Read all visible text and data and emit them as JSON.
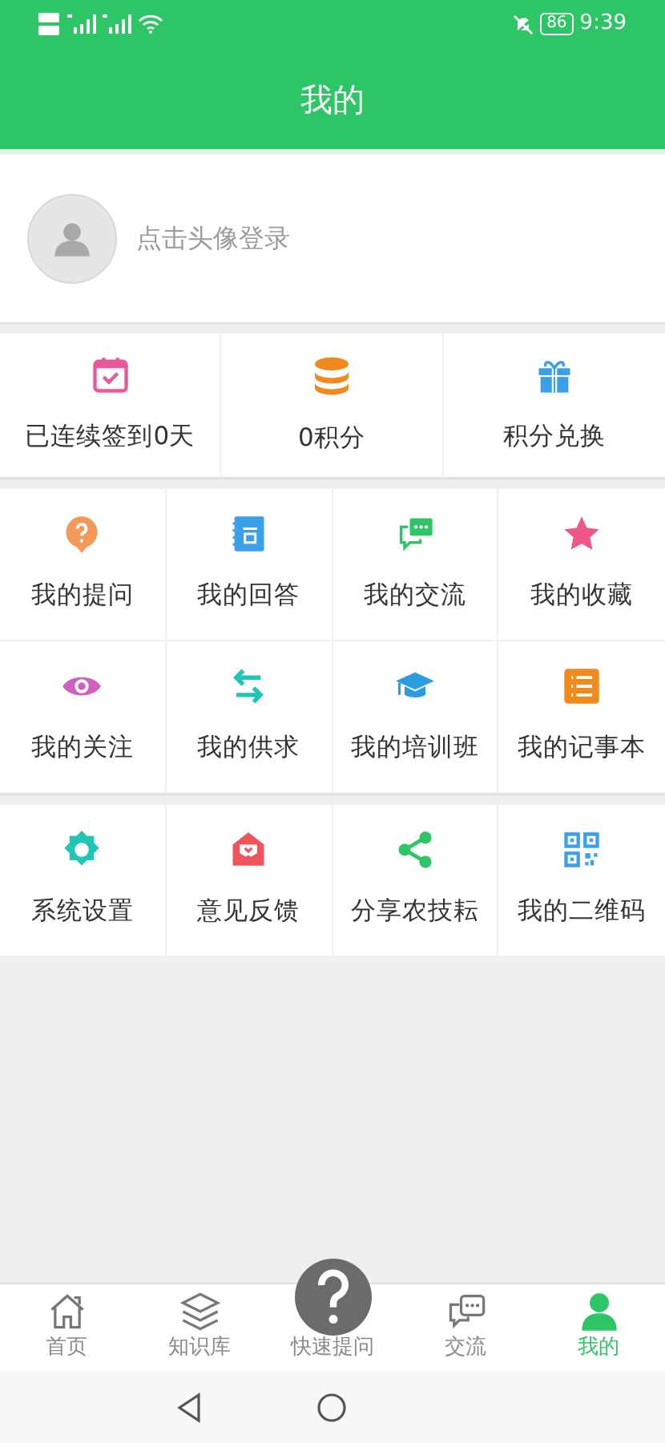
{
  "status_bar": {
    "battery": "86",
    "time": "9:39"
  },
  "header": {
    "title": "我的"
  },
  "profile": {
    "prompt": "点击头像登录"
  },
  "stats": [
    {
      "label": "已连续签到0天"
    },
    {
      "label": "0积分"
    },
    {
      "label": "积分兑换"
    }
  ],
  "menu_groups": [
    [
      {
        "label": "我的提问"
      },
      {
        "label": "我的回答"
      },
      {
        "label": "我的交流"
      },
      {
        "label": "我的收藏"
      },
      {
        "label": "我的关注"
      },
      {
        "label": "我的供求"
      },
      {
        "label": "我的培训班"
      },
      {
        "label": "我的记事本"
      }
    ],
    [
      {
        "label": "系统设置"
      },
      {
        "label": "意见反馈"
      },
      {
        "label": "分享农技耘"
      },
      {
        "label": "我的二维码"
      }
    ]
  ],
  "tab_bar": [
    {
      "label": "首页",
      "selected": false
    },
    {
      "label": "知识库",
      "selected": false
    },
    {
      "label": "快速提问",
      "selected": false
    },
    {
      "label": "交流",
      "selected": false
    },
    {
      "label": "我的",
      "selected": true
    }
  ]
}
